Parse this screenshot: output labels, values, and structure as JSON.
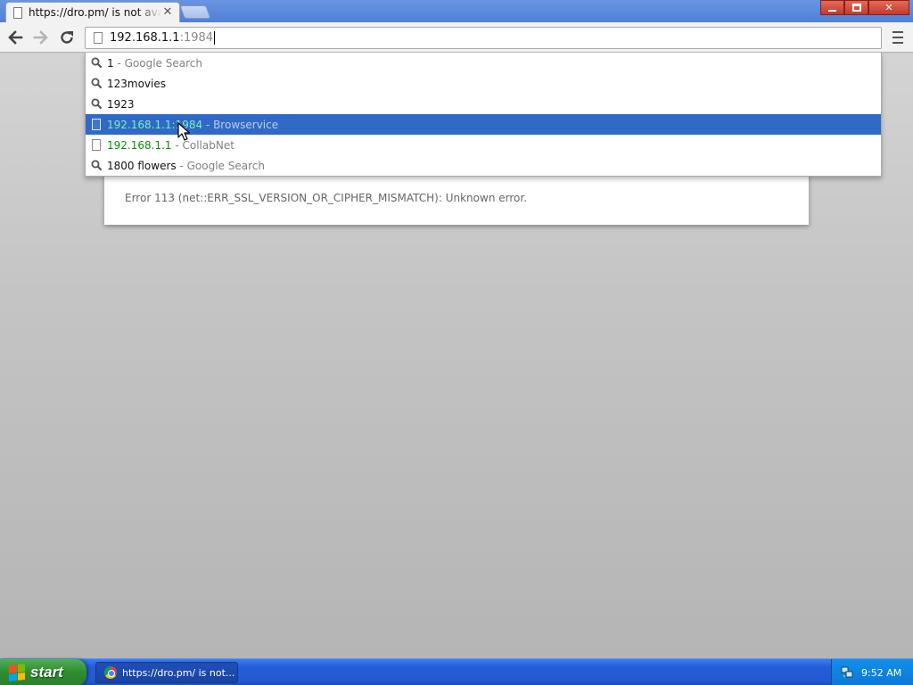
{
  "browser": {
    "tab": {
      "title": "https://dro.pm/ is not available",
      "close_glyph": "✕"
    },
    "window_controls": {
      "close_glyph": "✕"
    },
    "omnibox": {
      "typed": "192.168.1.1",
      "completion": ":1984"
    },
    "suggestions": [
      {
        "icon": "search-icon",
        "match": "1",
        "description": " - Google Search"
      },
      {
        "icon": "search-icon",
        "match": "123movies",
        "description": ""
      },
      {
        "icon": "search-icon",
        "match": "1923",
        "description": ""
      },
      {
        "icon": "page-icon",
        "match": "192.168.1.1:1984",
        "description": " - Browservice",
        "selected": true
      },
      {
        "icon": "page-icon",
        "match": "192.168.1.1",
        "description": " - CollabNet"
      },
      {
        "icon": "search-icon",
        "match": "1800 flowers",
        "description": " - Google Search"
      }
    ]
  },
  "page": {
    "error_message": "Error 113 (net::ERR_SSL_VERSION_OR_CIPHER_MISMATCH): Unknown error."
  },
  "taskbar": {
    "start_label": "start",
    "task_item_label": "https://dro.pm/ is not...",
    "clock": "9:52 AM"
  },
  "colors": {
    "selection": "#3169c6",
    "url_match": "#0b8a0b",
    "taskbar": "#245dd7",
    "start_button": "#2f8c31"
  }
}
